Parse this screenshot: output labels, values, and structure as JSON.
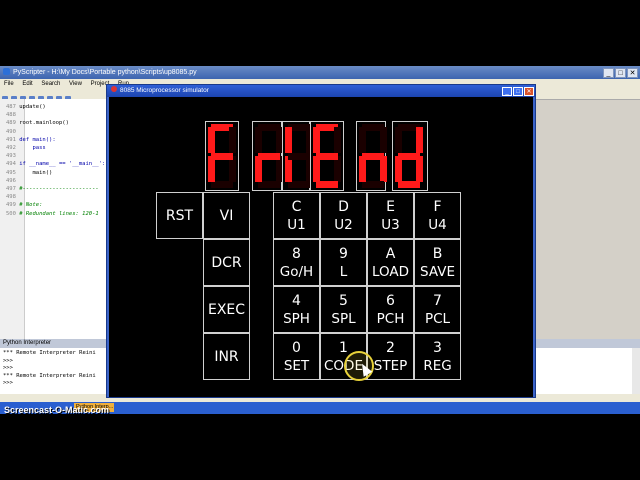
{
  "pyscripter": {
    "title": "PyScripter - H:\\My Docs\\Portable python\\Scripts\\up8085.py",
    "menu": [
      "File",
      "Edit",
      "Search",
      "View",
      "Project",
      "Run"
    ],
    "window_buttons": [
      "_",
      "□",
      "✕"
    ],
    "code_lines": [
      {
        "num": "487",
        "text": "update()",
        "kind": "code"
      },
      {
        "num": "488",
        "text": "",
        "kind": "code"
      },
      {
        "num": "489",
        "text": "root.mainloop()",
        "kind": "code"
      },
      {
        "num": "490",
        "text": "",
        "kind": "code"
      },
      {
        "num": "491",
        "text": "def main():",
        "kind": "kw"
      },
      {
        "num": "492",
        "text": "    pass",
        "kind": "kw"
      },
      {
        "num": "493",
        "text": "",
        "kind": "code"
      },
      {
        "num": "494",
        "text": "if __name__ == '__main__':",
        "kind": "kw"
      },
      {
        "num": "495",
        "text": "    main()",
        "kind": "code"
      },
      {
        "num": "496",
        "text": "",
        "kind": "code"
      },
      {
        "num": "497",
        "text": "#-----------------------",
        "kind": "cm"
      },
      {
        "num": "498",
        "text": "",
        "kind": "code"
      },
      {
        "num": "499",
        "text": "# Note:",
        "kind": "cm"
      },
      {
        "num": "500",
        "text": "# Redundant lines: 120-1",
        "kind": "cm"
      }
    ],
    "interpreter_title": "Python Interpreter",
    "interpreter_lines": [
      "*** Remote Interpreter Reini",
      ">>>",
      ">>>",
      "*** Remote Interpreter Reini",
      ">>>"
    ],
    "taskbar_item": "Python Interp..."
  },
  "watermark": "Screencast-O-Matic.com",
  "simulator": {
    "title": "8085 Microprocessor simulator",
    "window_buttons": [
      "_",
      "□",
      "✕"
    ],
    "display": {
      "text": "FrIEnd",
      "digits": [
        {
          "char": "F",
          "segments": [
            "a",
            "f",
            "g",
            "e"
          ]
        },
        {
          "char": "r",
          "segments": [
            "e",
            "g"
          ]
        },
        {
          "char": "I",
          "segments": [
            "f",
            "e"
          ]
        },
        {
          "char": "E",
          "segments": [
            "a",
            "f",
            "g",
            "e",
            "d"
          ]
        },
        {
          "char": "n",
          "segments": [
            "e",
            "g",
            "c"
          ]
        },
        {
          "char": "d",
          "segments": [
            "b",
            "c",
            "d",
            "e",
            "g"
          ]
        }
      ]
    },
    "left_keys": [
      {
        "id": "rst",
        "line1": "RST",
        "line2": ""
      },
      {
        "id": "vi",
        "line1": "VI",
        "line2": ""
      },
      {
        "id": "dcr",
        "line1": "DCR",
        "line2": ""
      },
      {
        "id": "exec",
        "line1": "EXEC",
        "line2": ""
      },
      {
        "id": "inr",
        "line1": "INR",
        "line2": ""
      }
    ],
    "keypad": [
      {
        "line1": "C",
        "line2": "U1"
      },
      {
        "line1": "D",
        "line2": "U2"
      },
      {
        "line1": "E",
        "line2": "U3"
      },
      {
        "line1": "F",
        "line2": "U4"
      },
      {
        "line1": "8",
        "line2": "Go/H"
      },
      {
        "line1": "9",
        "line2": "L"
      },
      {
        "line1": "A",
        "line2": "LOAD"
      },
      {
        "line1": "B",
        "line2": "SAVE"
      },
      {
        "line1": "4",
        "line2": "SPH"
      },
      {
        "line1": "5",
        "line2": "SPL"
      },
      {
        "line1": "6",
        "line2": "PCH"
      },
      {
        "line1": "7",
        "line2": "PCL"
      },
      {
        "line1": "0",
        "line2": "SET"
      },
      {
        "line1": "1",
        "line2": "CODE"
      },
      {
        "line1": "2",
        "line2": "STEP"
      },
      {
        "line1": "3",
        "line2": "REG"
      }
    ]
  }
}
